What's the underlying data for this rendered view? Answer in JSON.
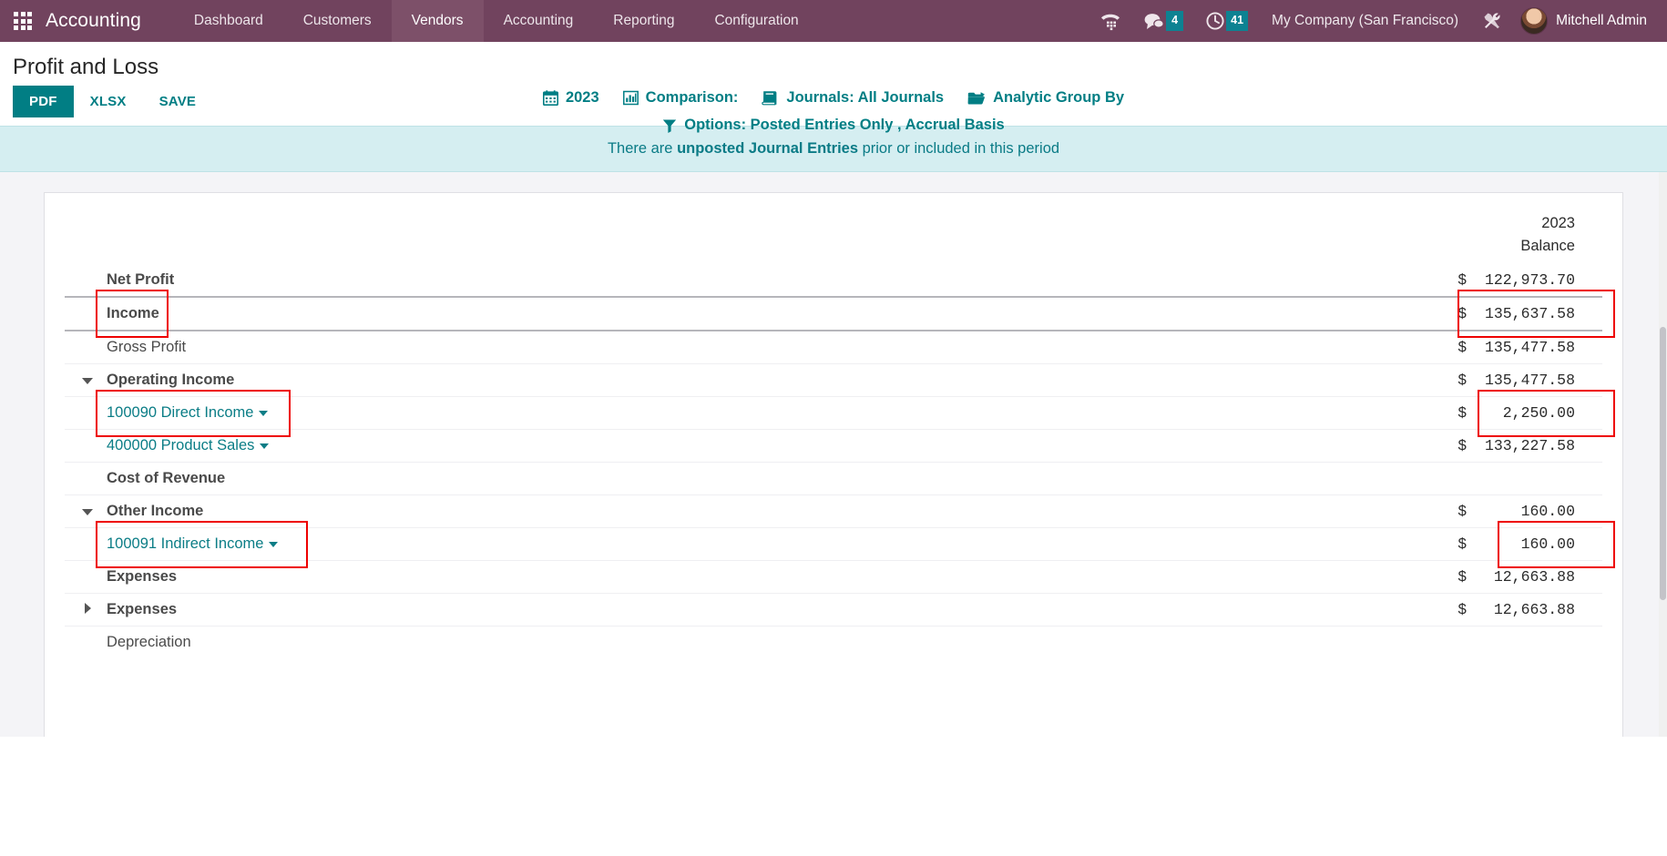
{
  "navbar": {
    "apps_icon": "apps-grid-icon",
    "brand": "Accounting",
    "menus": [
      {
        "label": "Dashboard",
        "active": false
      },
      {
        "label": "Customers",
        "active": false
      },
      {
        "label": "Vendors",
        "active": true
      },
      {
        "label": "Accounting",
        "active": false
      },
      {
        "label": "Reporting",
        "active": false
      },
      {
        "label": "Configuration",
        "active": false
      }
    ],
    "systray": {
      "voip_icon": "phone-dialpad-icon",
      "messages_icon": "chat-bubble-icon",
      "messages_count": "4",
      "activities_icon": "clock-icon",
      "activities_count": "41",
      "company": "My Company (San Francisco)",
      "debug_icon": "wrench-tools-icon",
      "user_name": "Mitchell Admin",
      "avatar_icon": "user-avatar"
    }
  },
  "control_panel": {
    "title": "Profit and Loss",
    "buttons": [
      {
        "label": "PDF",
        "style": "primary"
      },
      {
        "label": "XLSX",
        "style": "link"
      },
      {
        "label": "SAVE",
        "style": "link"
      }
    ],
    "filters_row1": [
      {
        "label": "2023",
        "icon": "calendar-icon"
      },
      {
        "label": "Comparison:",
        "icon": "bar-chart-icon"
      },
      {
        "label": "Journals: All Journals",
        "icon": "book-icon"
      },
      {
        "label": "Analytic Group By",
        "icon": "folder-open-icon"
      }
    ],
    "filters_row2": [
      {
        "label": "Options: Posted Entries Only , Accrual Basis",
        "icon": "filter-funnel-icon"
      }
    ]
  },
  "alert": {
    "prefix": "There are ",
    "bold": "unposted Journal Entries",
    "suffix": " prior or included in this period"
  },
  "report": {
    "column_headers": [
      "2023",
      "Balance"
    ],
    "rows": [
      {
        "name": "Net Profit",
        "amount": "$  122,973.70",
        "level": 0,
        "bold": true,
        "caret": "none",
        "link": false,
        "top_rule": "none",
        "highlight_name": false,
        "highlight_amount": false
      },
      {
        "name": "Income",
        "amount": "$  135,637.58",
        "level": 0,
        "bold": true,
        "caret": "none",
        "link": false,
        "top_rule": "thick",
        "highlight_name": true,
        "highlight_amount": true
      },
      {
        "name": "Gross Profit",
        "amount": "$  135,477.58",
        "level": 1,
        "bold": false,
        "caret": "none",
        "link": false,
        "top_rule": "thick",
        "highlight_name": false,
        "highlight_amount": false
      },
      {
        "name": "Operating Income",
        "amount": "$  135,477.58",
        "level": 2,
        "bold": true,
        "caret": "down",
        "link": false,
        "top_rule": "thin",
        "highlight_name": false,
        "highlight_amount": false
      },
      {
        "name": "100090 Direct Income",
        "amount": "$    2,250.00",
        "level": 3,
        "bold": false,
        "caret": "none",
        "link": true,
        "top_rule": "thin",
        "highlight_name": true,
        "highlight_amount": true
      },
      {
        "name": "400000 Product Sales",
        "amount": "$  133,227.58",
        "level": 3,
        "bold": false,
        "caret": "none",
        "link": true,
        "top_rule": "thin",
        "highlight_name": false,
        "highlight_amount": false
      },
      {
        "name": "Cost of Revenue",
        "amount": "",
        "level": 2,
        "bold": false,
        "caret": "none",
        "link": false,
        "top_rule": "thin",
        "highlight_name": false,
        "highlight_amount": false
      },
      {
        "name": "Other Income",
        "amount": "$      160.00",
        "level": 2,
        "bold": true,
        "caret": "down",
        "link": false,
        "top_rule": "thin",
        "highlight_name": false,
        "highlight_amount": false
      },
      {
        "name": "100091 Indirect Income",
        "amount": "$      160.00",
        "level": 3,
        "bold": false,
        "caret": "none",
        "link": true,
        "top_rule": "thin",
        "highlight_name": true,
        "highlight_amount": true
      },
      {
        "name": "Expenses",
        "amount": "$   12,663.88",
        "level": 1,
        "bold": true,
        "caret": "none",
        "link": false,
        "top_rule": "thin",
        "highlight_name": false,
        "highlight_amount": false
      },
      {
        "name": "Expenses",
        "amount": "$   12,663.88",
        "level": 2,
        "bold": false,
        "caret": "right",
        "link": false,
        "top_rule": "thin",
        "highlight_name": false,
        "highlight_amount": false
      },
      {
        "name": "Depreciation",
        "amount": "",
        "level": 1,
        "bold": false,
        "caret": "none",
        "link": false,
        "top_rule": "thin",
        "highlight_name": false,
        "highlight_amount": false
      }
    ]
  }
}
